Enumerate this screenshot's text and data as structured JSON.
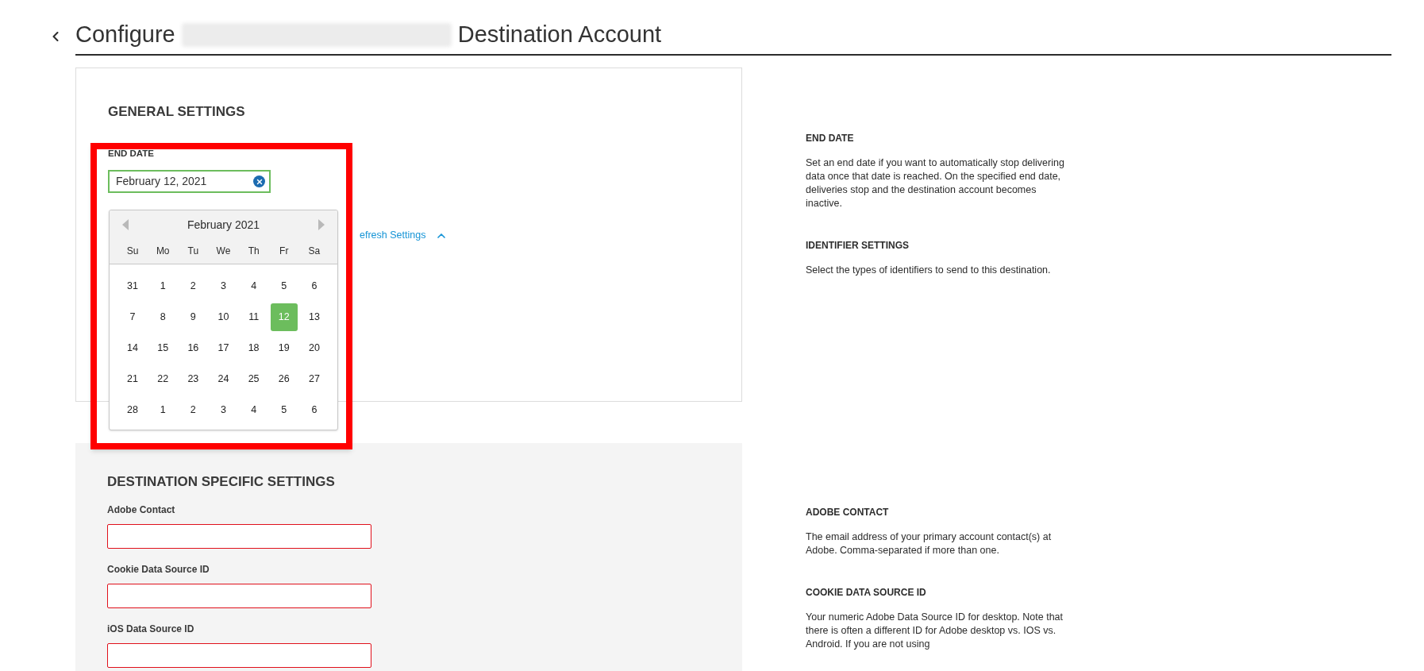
{
  "header": {
    "title_start": "Configure",
    "title_end": "Destination Account"
  },
  "general": {
    "heading": "GENERAL SETTINGS",
    "end_date_label": "END DATE",
    "end_date_value": "February 12, 2021",
    "refresh_link": "efresh Settings",
    "refresh_expanded": true
  },
  "calendar": {
    "month": "February 2021",
    "weekdays": [
      "Su",
      "Mo",
      "Tu",
      "We",
      "Th",
      "Fr",
      "Sa"
    ],
    "weeks": [
      [
        {
          "day": "31",
          "selected": false
        },
        {
          "day": "1",
          "selected": false
        },
        {
          "day": "2",
          "selected": false
        },
        {
          "day": "3",
          "selected": false
        },
        {
          "day": "4",
          "selected": false
        },
        {
          "day": "5",
          "selected": false
        },
        {
          "day": "6",
          "selected": false
        }
      ],
      [
        {
          "day": "7",
          "selected": false
        },
        {
          "day": "8",
          "selected": false
        },
        {
          "day": "9",
          "selected": false
        },
        {
          "day": "10",
          "selected": false
        },
        {
          "day": "11",
          "selected": false
        },
        {
          "day": "12",
          "selected": true
        },
        {
          "day": "13",
          "selected": false
        }
      ],
      [
        {
          "day": "14",
          "selected": false
        },
        {
          "day": "15",
          "selected": false
        },
        {
          "day": "16",
          "selected": false
        },
        {
          "day": "17",
          "selected": false
        },
        {
          "day": "18",
          "selected": false
        },
        {
          "day": "19",
          "selected": false
        },
        {
          "day": "20",
          "selected": false
        }
      ],
      [
        {
          "day": "21",
          "selected": false
        },
        {
          "day": "22",
          "selected": false
        },
        {
          "day": "23",
          "selected": false
        },
        {
          "day": "24",
          "selected": false
        },
        {
          "day": "25",
          "selected": false
        },
        {
          "day": "26",
          "selected": false
        },
        {
          "day": "27",
          "selected": false
        }
      ],
      [
        {
          "day": "28",
          "selected": false
        },
        {
          "day": "1",
          "selected": false
        },
        {
          "day": "2",
          "selected": false
        },
        {
          "day": "3",
          "selected": false
        },
        {
          "day": "4",
          "selected": false
        },
        {
          "day": "5",
          "selected": false
        },
        {
          "day": "6",
          "selected": false
        }
      ]
    ]
  },
  "destination": {
    "heading": "DESTINATION SPECIFIC SETTINGS",
    "fields": [
      {
        "label": "Adobe Contact",
        "invalid": true
      },
      {
        "label": "Cookie Data Source ID",
        "invalid": true
      },
      {
        "label": "iOS Data Source ID",
        "invalid": true
      }
    ]
  },
  "general_help": [
    {
      "title": "END DATE",
      "text": "Set an end date if you want to automatically stop delivering data once that date is reached. On the specified end date, deliveries stop and the destination account becomes inactive."
    },
    {
      "title": "IDENTIFIER SETTINGS",
      "text": "Select the types of identifiers to send to this destination."
    }
  ],
  "destination_help": [
    {
      "title": "ADOBE CONTACT",
      "text": "The email address of your primary account contact(s) at Adobe. Comma-separated if more than one."
    },
    {
      "title": "COOKIE DATA SOURCE ID",
      "text": "Your numeric Adobe Data Source ID for desktop. Note that there is often a different ID for Adobe desktop vs. IOS vs. Android. If you are not using"
    }
  ]
}
